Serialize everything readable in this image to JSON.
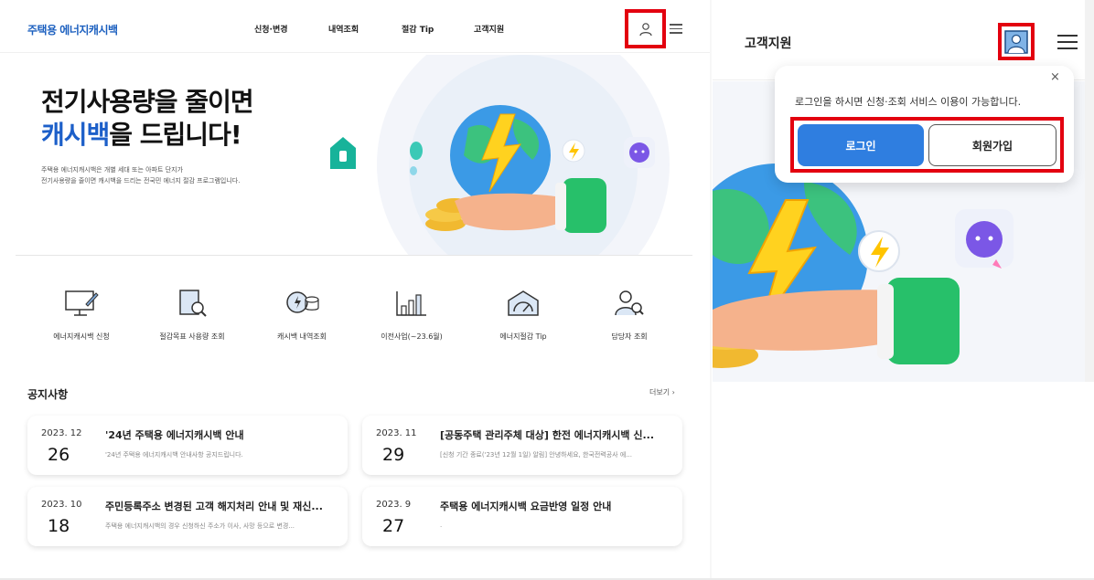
{
  "header": {
    "logo": "주택용 에너지캐시백",
    "nav": [
      "신청·변경",
      "내역조회",
      "절감 Tip",
      "고객지원"
    ]
  },
  "hero": {
    "title_line1": "전기사용량을 줄이면",
    "title_accent": "캐시백",
    "title_rest": "을 드립니다!",
    "desc_line1": "주택용 에너지캐시백은 개별 세대 또는 아파트 단지가",
    "desc_line2": "전기사용량을 줄이면 캐시백을 드리는 전국민 에너지 절감 프로그램입니다."
  },
  "quick_menu": [
    {
      "label": "에너지캐시백 신청",
      "icon": "monitor-pen-icon"
    },
    {
      "label": "절감목표 사용량 조회",
      "icon": "report-search-icon"
    },
    {
      "label": "캐시백 내역조회",
      "icon": "coin-stack-icon"
    },
    {
      "label": "이전사업(~23.6월)",
      "icon": "bar-chart-icon"
    },
    {
      "label": "에너지절감 Tip",
      "icon": "gauge-icon"
    },
    {
      "label": "담당자 조회",
      "icon": "person-search-icon"
    }
  ],
  "notices": {
    "title": "공지사항",
    "more": "더보기",
    "items": [
      {
        "ym": "2023. 12",
        "day": "26",
        "title": "'24년 주택용 에너지캐시백 안내",
        "desc": "'24년 주택용 에너지캐시백 안내사항 공지드립니다."
      },
      {
        "ym": "2023. 11",
        "day": "29",
        "title": "[공동주택 관리주체 대상] 한전 에너지캐시백 신...",
        "desc": "[신청 기간 종료('23년 12월 1일) 알림] 안녕하세요, 한국전력공사 에..."
      },
      {
        "ym": "2023. 10",
        "day": "18",
        "title": "주민등록주소 변경된 고객 해지처리 안내 및 재신...",
        "desc": "주택용 에너지캐시백의 경우 신청하신 주소가 이사, 사망 등으로 변경..."
      },
      {
        "ym": "2023. 9",
        "day": "27",
        "title": "주택용 에너지캐시백 요금반영 일정 안내",
        "desc": "."
      }
    ]
  },
  "mobile": {
    "title": "고객지원",
    "popup_message": "로그인을 하시면 신청·조회 서비스 이용이 가능합니다.",
    "close": "×",
    "login": "로그인",
    "signup": "회원가입"
  },
  "colors": {
    "brand": "#1c5fc9",
    "highlight": "#e3000f",
    "login_button": "#2f7ee0"
  }
}
